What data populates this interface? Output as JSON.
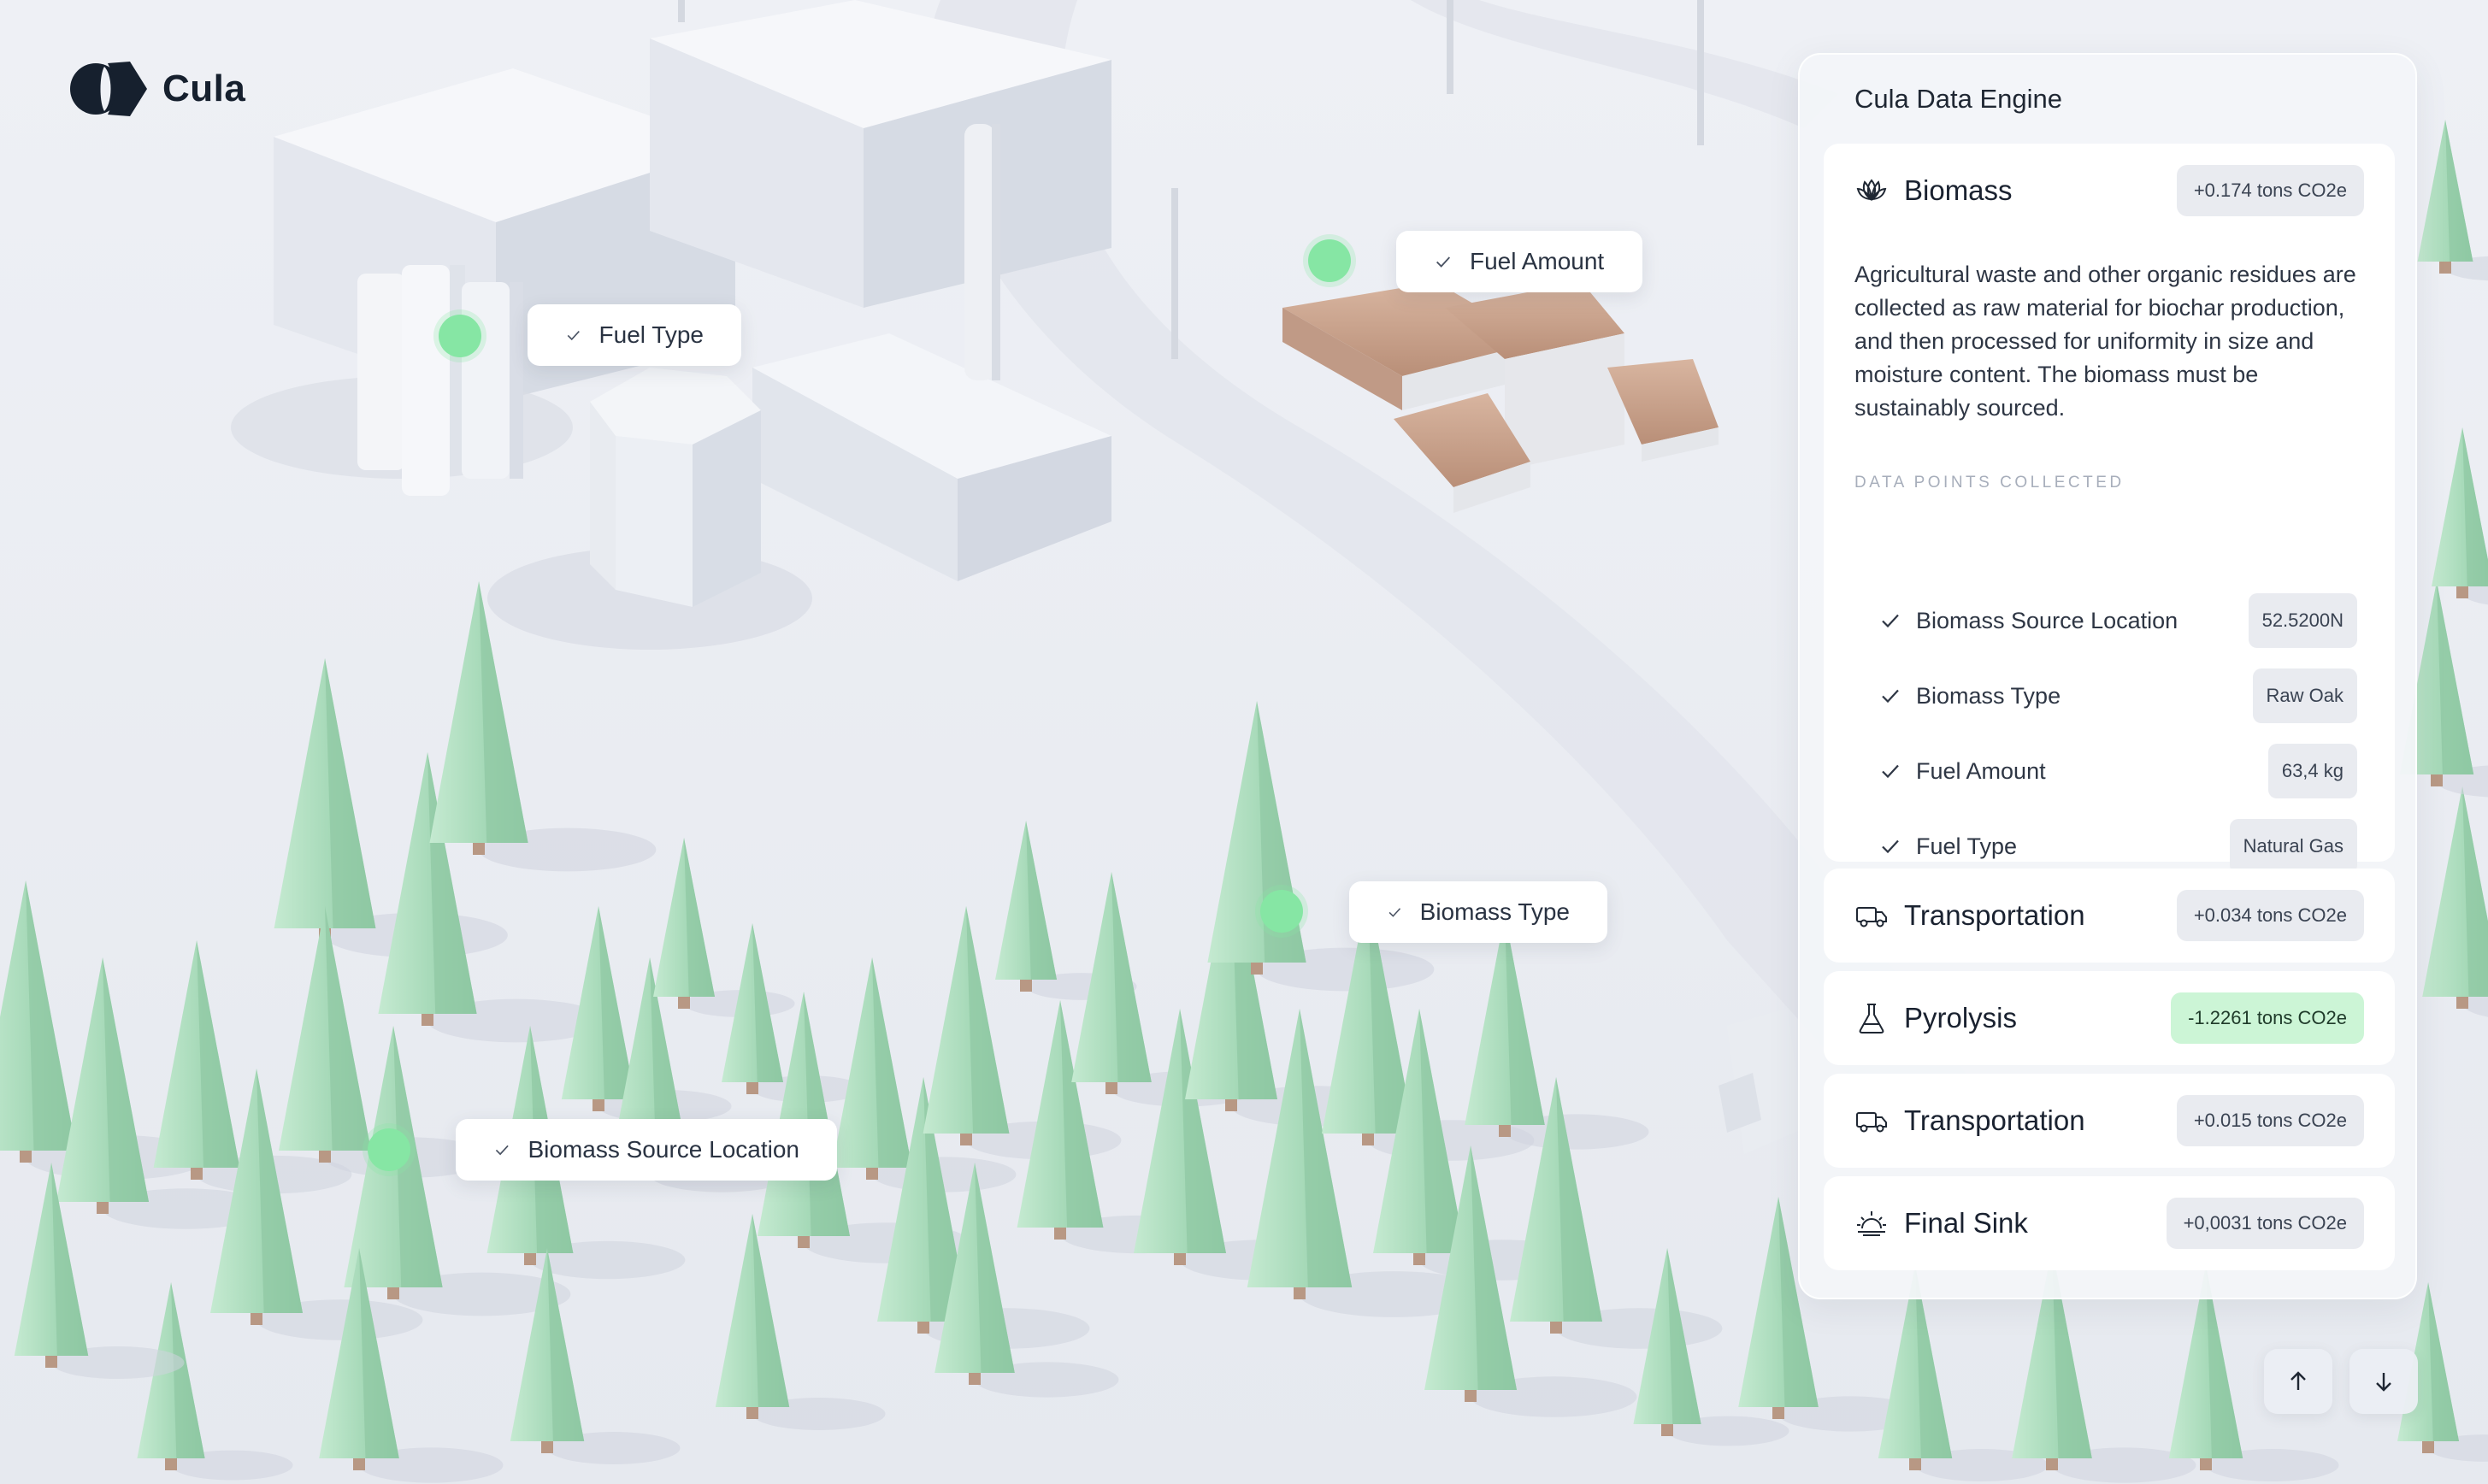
{
  "brand": {
    "name": "Cula"
  },
  "map_pins": [
    {
      "label": "Fuel Type"
    },
    {
      "label": "Fuel Amount"
    },
    {
      "label": "Biomass Type"
    },
    {
      "label": "Biomass Source Location"
    }
  ],
  "panel": {
    "title": "Cula Data Engine",
    "biomass": {
      "title": "Biomass",
      "badge": "+0.174 tons CO2e",
      "description": "Agricultural waste and other organic residues are collected as raw material for biochar production, and then processed for uniformity in size and moisture content. The biomass must be sustainably sourced.",
      "data_points_label": "DATA POINTS COLLECTED",
      "data_points": [
        {
          "label": "Biomass Source Location",
          "value": "52.5200N"
        },
        {
          "label": "Biomass Type",
          "value": "Raw Oak"
        },
        {
          "label": "Fuel Amount",
          "value": "63,4 kg"
        },
        {
          "label": "Fuel Type",
          "value": "Natural Gas"
        }
      ]
    },
    "stages": [
      {
        "title": "Transportation",
        "badge": "+0.034 tons CO2e",
        "icon": "truck-icon"
      },
      {
        "title": "Pyrolysis",
        "badge": "-1.2261 tons CO2e",
        "icon": "flask-icon"
      },
      {
        "title": "Transportation",
        "badge": "+0.015 tons CO2e",
        "icon": "truck-icon"
      },
      {
        "title": "Final Sink",
        "badge": "+0,0031 tons CO2e",
        "icon": "sunrise-icon"
      }
    ]
  },
  "colors": {
    "accent_green": "#86e6a4",
    "tree": "#a9dcbc",
    "ground": "#eceff4"
  }
}
